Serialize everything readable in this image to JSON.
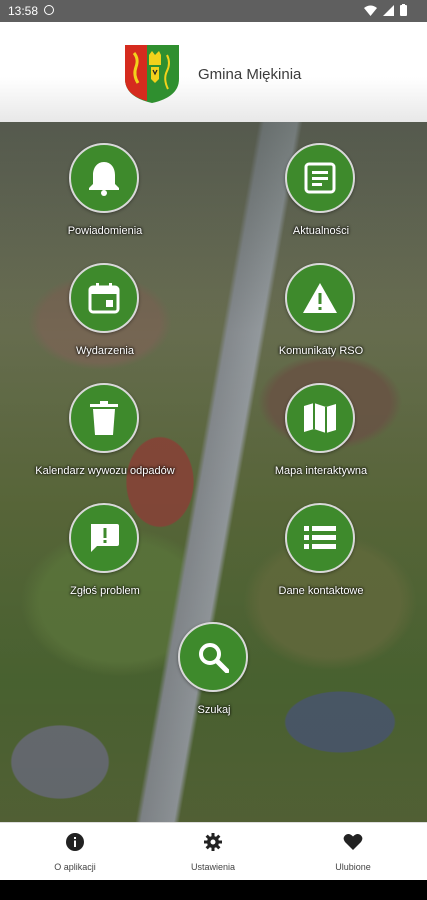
{
  "status_bar": {
    "time": "13:58"
  },
  "header": {
    "title": "Gmina Miękinia"
  },
  "tiles": [
    {
      "label": "Powiadomienia",
      "icon": "bell-icon"
    },
    {
      "label": "Aktualności",
      "icon": "news-icon"
    },
    {
      "label": "Wydarzenia",
      "icon": "calendar-icon"
    },
    {
      "label": "Komunikaty RSO",
      "icon": "warning-icon"
    },
    {
      "label": "Kalendarz wywozu odpadów",
      "icon": "trash-icon"
    },
    {
      "label": "Mapa interaktywna",
      "icon": "map-icon"
    },
    {
      "label": "Zgłoś problem",
      "icon": "report-icon"
    },
    {
      "label": "Dane kontaktowe",
      "icon": "list-icon"
    },
    {
      "label": "Szukaj",
      "icon": "search-icon"
    }
  ],
  "bottom_nav": {
    "items": [
      {
        "label": "O aplikacji",
        "icon": "info-icon"
      },
      {
        "label": "Ustawienia",
        "icon": "gear-icon"
      },
      {
        "label": "Ulubione",
        "icon": "heart-icon"
      }
    ]
  },
  "colors": {
    "tile_green": "#3e8a2c",
    "crest_red": "#d52b1e",
    "crest_green": "#2f8f2f"
  }
}
